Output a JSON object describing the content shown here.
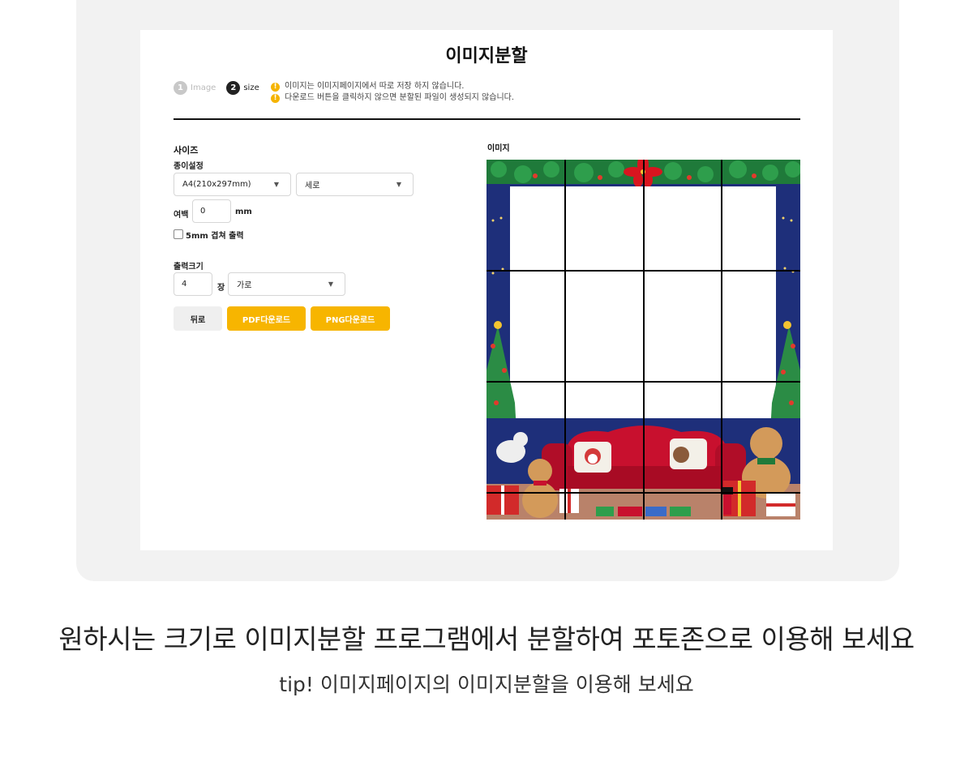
{
  "panel": {
    "title": "이미지분할",
    "steps": [
      {
        "number": "1",
        "label": "Image"
      },
      {
        "number": "2",
        "label": "size"
      }
    ],
    "notices": [
      "이미지는 이미지페이지에서 따로 저장 하지 않습니다.",
      "다운로드 버튼을 클릭하지 않으면 분할된 파일이 생성되지 않습니다."
    ],
    "size_section": {
      "heading": "사이즈",
      "paper_label": "종이설정",
      "paper_size": "A4(210x297mm)",
      "orientation": "세로",
      "margin_label": "여백",
      "margin_value": "0",
      "margin_unit": "mm",
      "overlap_label": "5mm 겹쳐 출력",
      "overlap_checked": false
    },
    "output_section": {
      "heading": "출력크기",
      "count_value": "4",
      "count_unit": "장",
      "direction": "가로"
    },
    "buttons": {
      "back": "뒤로",
      "pdf": "PDF다운로드",
      "png": "PNG다운로드"
    },
    "image_label": "이미지",
    "grid": {
      "columns": 4,
      "rows": 4
    }
  },
  "caption": {
    "main": "원하시는 크기로 이미지분할 프로그램에서 분할하여 포토존으로 이용해 보세요",
    "sub": "tip! 이미지페이지의 이미지분할을 이용해 보세요"
  },
  "colors": {
    "accent": "#f7b500",
    "navy_background": "#1e2f7a",
    "sofa_red": "#c8102e"
  }
}
